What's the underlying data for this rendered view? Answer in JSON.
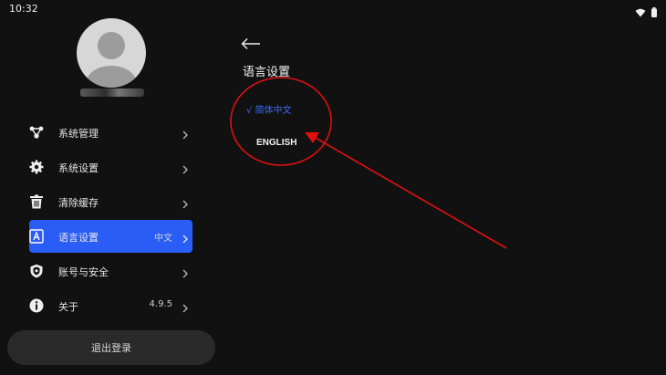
{
  "status": {
    "time": "10:32",
    "icons": [
      "wifi-icon",
      "battery-icon"
    ]
  },
  "sidebar": {
    "menu": [
      {
        "label": "系统管理",
        "value": "",
        "icon": "nodes-icon"
      },
      {
        "label": "系统设置",
        "value": "",
        "icon": "gear-icon"
      },
      {
        "label": "清除缓存",
        "value": "",
        "icon": "trash-icon"
      },
      {
        "label": "语言设置",
        "value": "中文",
        "icon": "language-icon",
        "active": true
      },
      {
        "label": "账号与安全",
        "value": "",
        "icon": "shield-icon"
      },
      {
        "label": "关于",
        "value": "4.9.5",
        "icon": "info-icon"
      }
    ],
    "logout_label": "退出登录"
  },
  "content": {
    "title": "语言设置",
    "options": [
      {
        "label": "√ 简体中文",
        "selected": true
      },
      {
        "label": "ENGLISH",
        "selected": false
      }
    ]
  },
  "colors": {
    "accent": "#2a5df6",
    "selected_text": "#3a6df8",
    "annotation": "#e01010",
    "background": "#111112"
  }
}
